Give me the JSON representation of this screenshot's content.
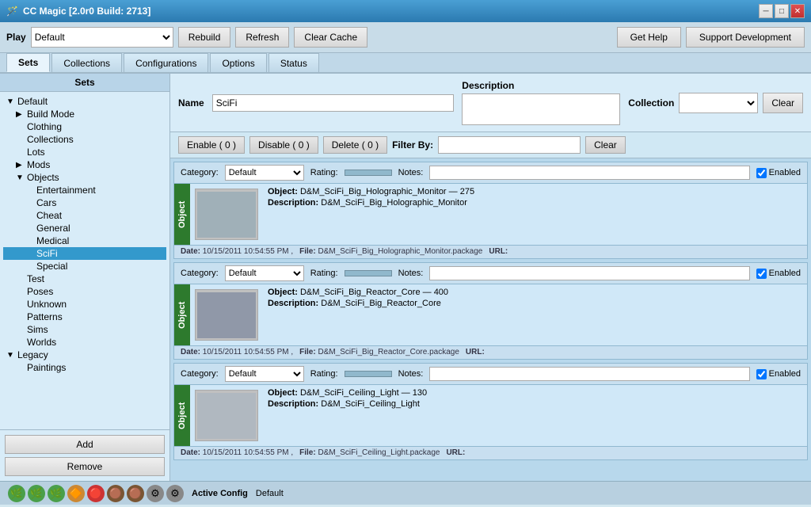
{
  "titleBar": {
    "title": "CC Magic [2.0r0 Build: 2713]",
    "controls": [
      "minimize",
      "maximize",
      "close"
    ]
  },
  "toolbar": {
    "play_label": "Play",
    "play_default": "Default",
    "rebuild_label": "Rebuild",
    "refresh_label": "Refresh",
    "clear_cache_label": "Clear Cache",
    "get_help_label": "Get Help",
    "support_label": "Support Development"
  },
  "tabs": {
    "items": [
      "Sets",
      "Collections",
      "Configurations",
      "Options",
      "Status"
    ],
    "active": "Sets"
  },
  "sidebar": {
    "title": "Sets",
    "tree": [
      {
        "id": "default",
        "label": "Default",
        "level": 0,
        "arrow": "▼",
        "selected": false
      },
      {
        "id": "build-mode",
        "label": "Build Mode",
        "level": 1,
        "arrow": "▶",
        "selected": false
      },
      {
        "id": "clothing",
        "label": "Clothing",
        "level": 1,
        "arrow": "",
        "selected": false
      },
      {
        "id": "collections",
        "label": "Collections",
        "level": 1,
        "arrow": "",
        "selected": false
      },
      {
        "id": "lots",
        "label": "Lots",
        "level": 1,
        "arrow": "",
        "selected": false
      },
      {
        "id": "mods",
        "label": "Mods",
        "level": 1,
        "arrow": "▶",
        "selected": false
      },
      {
        "id": "objects",
        "label": "Objects",
        "level": 1,
        "arrow": "▼",
        "selected": false
      },
      {
        "id": "entertainment",
        "label": "Entertainment",
        "level": 2,
        "arrow": "",
        "selected": false
      },
      {
        "id": "cars",
        "label": "Cars",
        "level": 2,
        "arrow": "",
        "selected": false
      },
      {
        "id": "cheat",
        "label": "Cheat",
        "level": 2,
        "arrow": "",
        "selected": false
      },
      {
        "id": "general",
        "label": "General",
        "level": 2,
        "arrow": "",
        "selected": false
      },
      {
        "id": "medical",
        "label": "Medical",
        "level": 2,
        "arrow": "",
        "selected": false
      },
      {
        "id": "scifi",
        "label": "SciFi",
        "level": 2,
        "arrow": "",
        "selected": true
      },
      {
        "id": "special",
        "label": "Special",
        "level": 2,
        "arrow": "",
        "selected": false
      },
      {
        "id": "test",
        "label": "Test",
        "level": 1,
        "arrow": "",
        "selected": false
      },
      {
        "id": "poses",
        "label": "Poses",
        "level": 1,
        "arrow": "",
        "selected": false
      },
      {
        "id": "unknown",
        "label": "Unknown",
        "level": 1,
        "arrow": "",
        "selected": false
      },
      {
        "id": "patterns",
        "label": "Patterns",
        "level": 1,
        "arrow": "",
        "selected": false
      },
      {
        "id": "sims",
        "label": "Sims",
        "level": 1,
        "arrow": "",
        "selected": false
      },
      {
        "id": "worlds",
        "label": "Worlds",
        "level": 1,
        "arrow": "",
        "selected": false
      },
      {
        "id": "legacy",
        "label": "Legacy",
        "level": 0,
        "arrow": "▼",
        "selected": false
      },
      {
        "id": "paintings",
        "label": "Paintings",
        "level": 1,
        "arrow": "",
        "selected": false
      }
    ],
    "add_label": "Add",
    "remove_label": "Remove"
  },
  "contentHeader": {
    "name_label": "Name",
    "name_value": "SciFi",
    "description_label": "Description",
    "description_value": "",
    "collection_label": "Collection",
    "collection_value": "",
    "clear_label": "Clear"
  },
  "actionBar": {
    "enable_label": "Enable ( 0 )",
    "disable_label": "Disable ( 0 )",
    "delete_label": "Delete ( 0 )",
    "filter_label": "Filter By:",
    "filter_value": "",
    "clear_label": "Clear"
  },
  "items": [
    {
      "id": "item1",
      "side_label": "Object",
      "category": "Default",
      "rating": "",
      "notes": "",
      "enabled": true,
      "object_name": "D&M_SciFi_Big_Holographic_Monitor",
      "object_id": "275",
      "description": "D&M_SciFi_Big_Holographic_Monitor",
      "date": "10/15/2011 10:54:55 PM",
      "file": "D&M_SciFi_Big_Holographic_Monitor.package",
      "url": "",
      "thumb_color": "#a0b0b8"
    },
    {
      "id": "item2",
      "side_label": "Object",
      "category": "Default",
      "rating": "",
      "notes": "",
      "enabled": true,
      "object_name": "D&M_SciFi_Big_Reactor_Core",
      "object_id": "400",
      "description": "D&M_SciFi_Big_Reactor_Core",
      "date": "10/15/2011 10:54:55 PM",
      "file": "D&M_SciFi_Big_Reactor_Core.package",
      "url": "",
      "thumb_color": "#9098a8"
    },
    {
      "id": "item3",
      "side_label": "Object",
      "category": "Default",
      "rating": "",
      "notes": "",
      "enabled": true,
      "object_name": "D&M_SciFi_Ceiling_Light",
      "object_id": "130",
      "description": "D&M_SciFi_Ceiling_Light",
      "date": "10/15/2011 10:54:55 PM",
      "file": "D&M_SciFi_Ceiling_Light.package",
      "url": "",
      "thumb_color": "#b0b8c0"
    }
  ],
  "statusBar": {
    "active_config_label": "Active Config",
    "active_config_value": "Default",
    "icons": [
      "green",
      "green",
      "green",
      "orange",
      "red",
      "brown",
      "brown",
      "gray",
      "gray"
    ]
  }
}
